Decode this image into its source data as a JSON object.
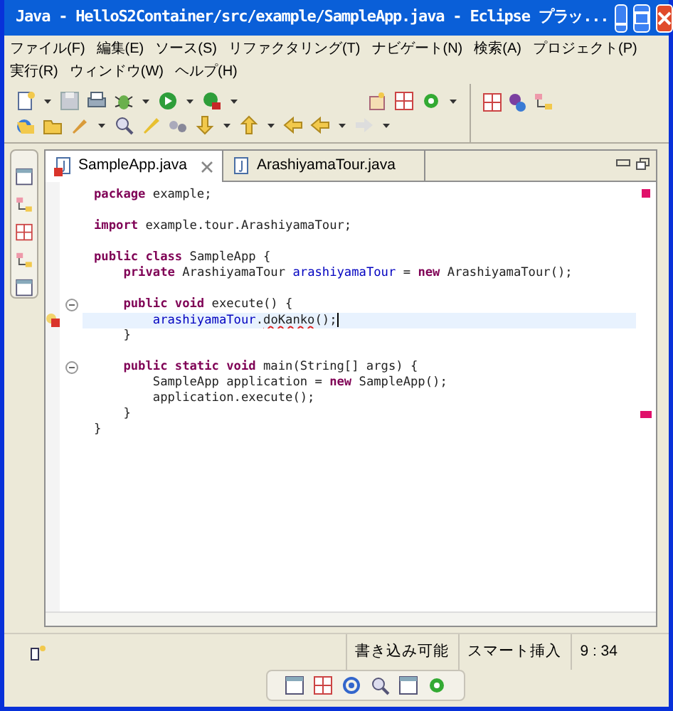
{
  "window": {
    "title": "Java - HelloS2Container/src/example/SampleApp.java - Eclipse プラッ..."
  },
  "menu": [
    "ファイル(F)",
    "編集(E)",
    "ソース(S)",
    "リファクタリング(T)",
    "ナビゲート(N)",
    "検索(A)",
    "プロジェクト(P)",
    "実行(R)",
    "ウィンドウ(W)",
    "ヘルプ(H)"
  ],
  "tabs": [
    {
      "label": "SampleApp.java",
      "selected": true,
      "error": true
    },
    {
      "label": "ArashiyamaTour.java",
      "selected": false,
      "error": false
    }
  ],
  "code": [
    {
      "kind": "code",
      "selected": false,
      "error": false,
      "fold": false,
      "segments": [
        {
          "kind": "keyword",
          "text": "package"
        },
        {
          "kind": "plain",
          "text": " example;"
        }
      ]
    },
    {
      "kind": "blank"
    },
    {
      "kind": "code",
      "selected": false,
      "error": false,
      "fold": false,
      "segments": [
        {
          "kind": "keyword",
          "text": "import"
        },
        {
          "kind": "plain",
          "text": " example.tour.ArashiyamaTour;"
        }
      ]
    },
    {
      "kind": "blank"
    },
    {
      "kind": "code",
      "selected": false,
      "error": false,
      "fold": false,
      "segments": [
        {
          "kind": "keyword",
          "text": "public class"
        },
        {
          "kind": "plain",
          "text": " SampleApp {"
        }
      ]
    },
    {
      "kind": "code",
      "selected": false,
      "error": false,
      "fold": false,
      "segments": [
        {
          "kind": "keyword",
          "text": "    private"
        },
        {
          "kind": "plain",
          "text": " ArashiyamaTour "
        },
        {
          "kind": "field",
          "text": "arashiyamaTour"
        },
        {
          "kind": "plain",
          "text": " = "
        },
        {
          "kind": "keyword",
          "text": "new"
        },
        {
          "kind": "plain",
          "text": " ArashiyamaTour();"
        }
      ]
    },
    {
      "kind": "blank"
    },
    {
      "kind": "code",
      "selected": false,
      "error": false,
      "fold": true,
      "segments": [
        {
          "kind": "keyword",
          "text": "    public void"
        },
        {
          "kind": "plain",
          "text": " execute() {"
        }
      ]
    },
    {
      "kind": "code",
      "selected": true,
      "error": true,
      "fold": false,
      "segments": [
        {
          "kind": "field",
          "text": "        arashiyamaTour"
        },
        {
          "kind": "plain",
          "text": "."
        },
        {
          "kind": "error",
          "text": "doKanko"
        },
        {
          "kind": "plain",
          "text": "();"
        }
      ]
    },
    {
      "kind": "code",
      "selected": false,
      "error": false,
      "fold": false,
      "segments": [
        {
          "kind": "plain",
          "text": "    }"
        }
      ]
    },
    {
      "kind": "blank"
    },
    {
      "kind": "code",
      "selected": false,
      "error": false,
      "fold": true,
      "segments": [
        {
          "kind": "keyword",
          "text": "    public static void"
        },
        {
          "kind": "plain",
          "text": " main(String[] args) {"
        }
      ]
    },
    {
      "kind": "code",
      "selected": false,
      "error": false,
      "fold": false,
      "segments": [
        {
          "kind": "plain",
          "text": "        SampleApp application = "
        },
        {
          "kind": "keyword",
          "text": "new"
        },
        {
          "kind": "plain",
          "text": " SampleApp();"
        }
      ]
    },
    {
      "kind": "code",
      "selected": false,
      "error": false,
      "fold": false,
      "segments": [
        {
          "kind": "plain",
          "text": "        application.execute();"
        }
      ]
    },
    {
      "kind": "code",
      "selected": false,
      "error": false,
      "fold": false,
      "segments": [
        {
          "kind": "plain",
          "text": "    }"
        }
      ]
    },
    {
      "kind": "code",
      "selected": false,
      "error": false,
      "fold": false,
      "segments": [
        {
          "kind": "plain",
          "text": "}"
        }
      ]
    }
  ],
  "status_bar": [
    "書き込み可能",
    "スマート挿入",
    "9 : 34"
  ]
}
